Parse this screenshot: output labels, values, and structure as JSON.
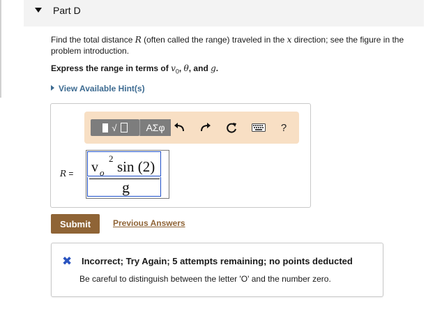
{
  "part": {
    "title": "Part D"
  },
  "prompt": {
    "text_before": "Find the total distance ",
    "var_r": "R",
    "text_middle": " (often called the range) traveled in the ",
    "var_x": "x",
    "text_after": " direction; see the figure in the problem introduction."
  },
  "instruction": {
    "prefix": "Express the range in terms of ",
    "vars": "v",
    "vars_sub": "0",
    "var_theta": "θ",
    "and": ", and ",
    "var_g": "g",
    "comma": ", ",
    "end": "."
  },
  "hints": {
    "label": "View Available Hint(s)"
  },
  "toolbar": {
    "symbols_label": "ΑΣφ",
    "help_label": "?",
    "icons": [
      "template-icon",
      "undo-icon",
      "redo-icon",
      "reset-icon",
      "keyboard-icon",
      "help-icon"
    ]
  },
  "answer": {
    "label_var": "R",
    "label_eq": " =",
    "numerator_v": "v",
    "numerator_sub": "o",
    "numerator_sup": "2",
    "numerator_func": "sin (2)",
    "denominator": "g"
  },
  "actions": {
    "submit_label": "Submit",
    "previous_label": "Previous Answers"
  },
  "feedback": {
    "icon": "✖",
    "title": "Incorrect; Try Again; 5 attempts remaining; no points deducted",
    "message": "Be careful to distinguish between the letter 'O' and the number zero."
  },
  "colors": {
    "submit": "#8f6436",
    "link": "#3d6b91",
    "toolbar_bg": "#f8dfc4",
    "incorrect_icon": "#2a54c0"
  }
}
